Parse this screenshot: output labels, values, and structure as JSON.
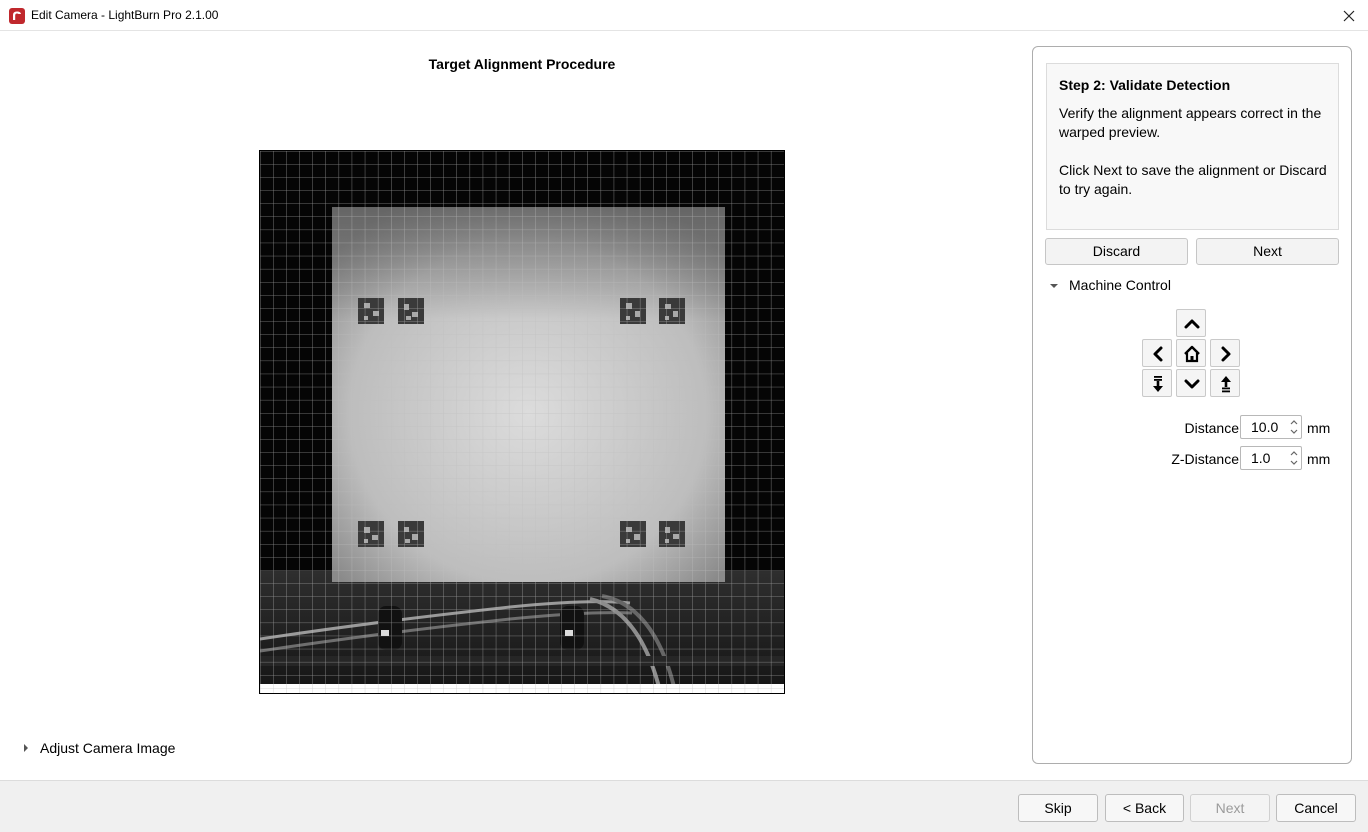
{
  "window": {
    "title": "Edit Camera - LightBurn Pro 2.1.00"
  },
  "main": {
    "procedure_title": "Target Alignment Procedure",
    "adjust_camera_label": "Adjust Camera Image"
  },
  "step": {
    "title": "Step 2: Validate Detection",
    "paragraph1": "Verify the alignment appears correct in the warped preview.",
    "paragraph2": "Click Next to save the alignment or Discard to try again."
  },
  "step_buttons": {
    "discard": "Discard",
    "next": "Next"
  },
  "machine_control": {
    "label": "Machine Control",
    "distance_label": "Distance",
    "distance_value": "10.0",
    "distance_unit": "mm",
    "z_distance_label": "Z-Distance",
    "z_distance_value": "1.0",
    "z_distance_unit": "mm"
  },
  "footer": {
    "skip": "Skip",
    "back": "< Back",
    "next": "Next",
    "cancel": "Cancel"
  },
  "colors": {
    "brand_red": "#c0282d",
    "panel_border": "#adadad",
    "disabled_text": "#9a9a9a"
  },
  "icons": [
    "app-logo-icon",
    "close-icon",
    "expand-arrow-icon",
    "collapse-arrow-icon",
    "jog-up-icon",
    "jog-left-icon",
    "home-icon",
    "jog-right-icon",
    "z-down-icon",
    "jog-down-icon",
    "z-up-icon",
    "spin-up-icon",
    "spin-down-icon"
  ]
}
